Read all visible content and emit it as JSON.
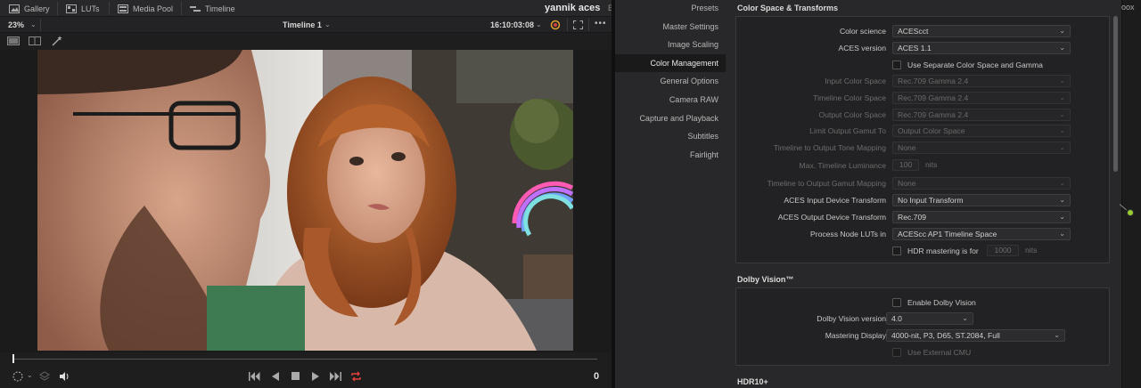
{
  "topbar": {
    "tabs": [
      {
        "label": "Gallery",
        "icon": "gallery-icon"
      },
      {
        "label": "LUTs",
        "icon": "luts-icon"
      },
      {
        "label": "Media Pool",
        "icon": "media-pool-icon"
      },
      {
        "label": "Timeline",
        "icon": "timeline-icon"
      }
    ],
    "project_title": "yannik aces",
    "project_extra": "Ed"
  },
  "viewer": {
    "zoom": "23%",
    "timeline_name": "Timeline 1",
    "timecode": "16:10:03:08",
    "frame_count": "0"
  },
  "settings_nav": {
    "items": [
      "Presets",
      "Master Settings",
      "Image Scaling",
      "Color Management",
      "General Options",
      "Camera RAW",
      "Capture and Playback",
      "Subtitles",
      "Fairlight"
    ],
    "active": "Color Management"
  },
  "color_space": {
    "title": "Color Space & Transforms",
    "color_science": {
      "label": "Color science",
      "value": "ACEScct"
    },
    "aces_version": {
      "label": "ACES version",
      "value": "ACES 1.1"
    },
    "separate_cs": {
      "label": "Use Separate Color Space and Gamma"
    },
    "input_cs": {
      "label": "Input Color Space",
      "value": "Rec.709 Gamma 2.4"
    },
    "timeline_cs": {
      "label": "Timeline Color Space",
      "value": "Rec.709 Gamma 2.4"
    },
    "output_cs": {
      "label": "Output Color Space",
      "value": "Rec.709 Gamma 2.4"
    },
    "limit_gamut": {
      "label": "Limit Output Gamut To",
      "value": "Output Color Space"
    },
    "tone_mapping": {
      "label": "Timeline to Output Tone Mapping",
      "value": "None"
    },
    "max_lum": {
      "label": "Max. Timeline Luminance",
      "value": "100",
      "unit": "nits"
    },
    "gamut_mapping": {
      "label": "Timeline to Output Gamut Mapping",
      "value": "None"
    },
    "aces_idt": {
      "label": "ACES Input Device Transform",
      "value": "No Input Transform"
    },
    "aces_odt": {
      "label": "ACES Output Device Transform",
      "value": "Rec.709"
    },
    "process_luts": {
      "label": "Process Node LUTs in",
      "value": "ACEScc AP1 Timeline Space"
    },
    "hdr_mastering": {
      "label": "HDR mastering is for",
      "value": "1000",
      "unit": "nits"
    }
  },
  "dolby": {
    "title": "Dolby Vision™",
    "enable": {
      "label": "Enable Dolby Vision"
    },
    "version": {
      "label": "Dolby Vision version",
      "value": "4.0"
    },
    "mastering": {
      "label": "Mastering Display",
      "value": "4000-nit, P3, D65, ST.2084, Full"
    },
    "external_cmu": {
      "label": "Use External CMU"
    }
  },
  "hdr10": {
    "title": "HDR10+"
  },
  "right_strip": {
    "label": "oox"
  }
}
